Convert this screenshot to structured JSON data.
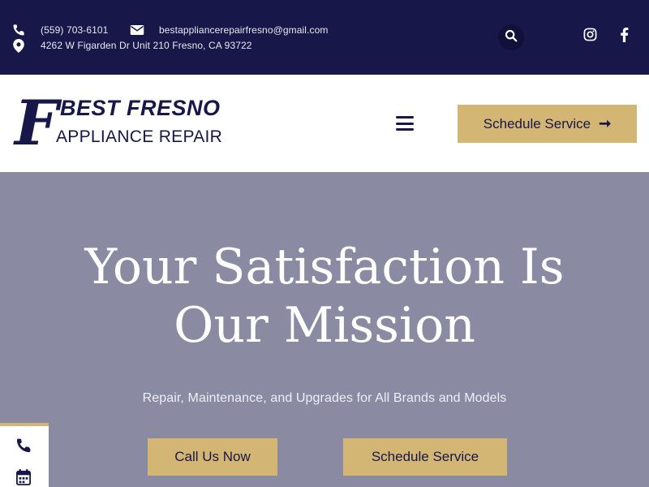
{
  "topbar": {
    "phone": "(559) 703-6101",
    "email": "bestappliancerepairfresno@gmail.com",
    "address": "4262 W Figarden Dr Unit 210 Fresno, CA 93722"
  },
  "logo": {
    "letter": "F",
    "line1": "BEST FRESNO",
    "line2": "APPLIANCE REPAIR"
  },
  "header": {
    "schedule_label": "Schedule Service",
    "schedule_arrow": "➞"
  },
  "hero": {
    "title": "Your Satisfaction Is Our Mission",
    "subtitle": "Repair, Maintenance, and Upgrades for All Brands and Models",
    "call_label": "Call Us Now",
    "schedule_label": "Schedule Service"
  },
  "colors": {
    "navy": "#17174a",
    "gold": "#d3b574",
    "hero_overlay": "#8a8ba3"
  },
  "icons": [
    "phone-icon",
    "envelope-icon",
    "map-marker-icon",
    "search-icon",
    "instagram-icon",
    "facebook-icon",
    "hamburger-menu-icon",
    "calendar-icon"
  ]
}
